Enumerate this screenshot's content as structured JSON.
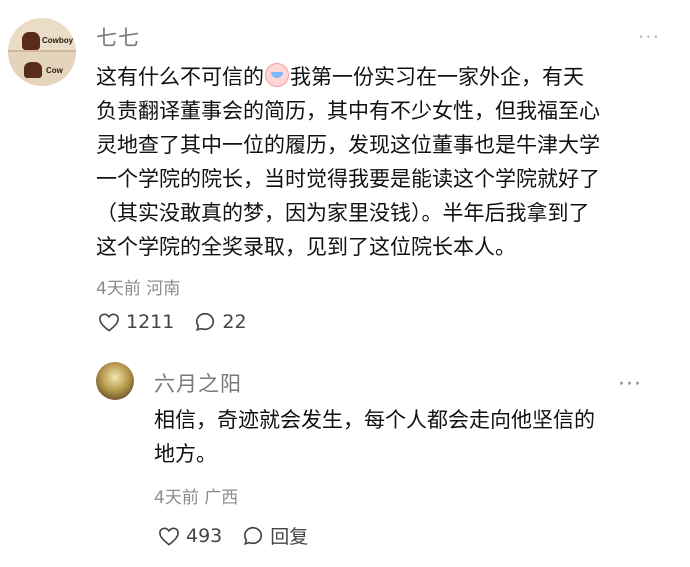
{
  "comment": {
    "username": "七七",
    "avatar_texts": [
      "Cowboy",
      "Cow"
    ],
    "lines": [
      "这有什么不可信的",
      "我第一份实习在一家外企，有天",
      "负责翻译董事会的简历，其中有不少女性，但我福至心",
      "灵地查了其中一位的履历，发现这位董事也是牛津大学",
      "一个学院的院长，当时觉得我要是能读这个学院就好了",
      "（其实没敢真的梦，因为家里没钱）。半年后我拿到了",
      "这个学院的全奖录取，见到了这位院长本人。"
    ],
    "emoji_icon": "face-with-tears-icon",
    "time": "4天前",
    "location": "河南",
    "likes": "1211",
    "comments": "22"
  },
  "reply": {
    "username": "六月之阳",
    "lines": [
      "相信，奇迹就会发生，每个人都会走向他坚信的",
      "地方。"
    ],
    "time": "4天前",
    "location": "广西",
    "likes": "493",
    "reply_label": "回复"
  },
  "colors": {
    "muted": "#8c8c8c",
    "text": "#111111",
    "username": "#7a7a7a"
  }
}
